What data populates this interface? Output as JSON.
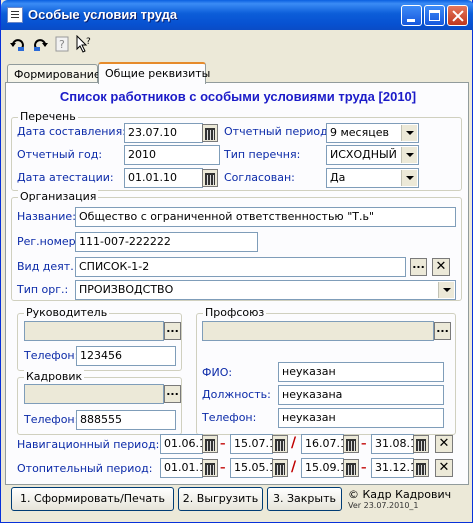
{
  "window": {
    "title": "Особые условия труда"
  },
  "toolbar": {
    "icons": [
      "undo-icon",
      "redo-icon",
      "help-icon",
      "context-help-icon"
    ]
  },
  "tabs": [
    {
      "label": "Формирование",
      "active": false
    },
    {
      "label": "Общие реквизиты",
      "active": true
    }
  ],
  "heading": "Список работников с особыми условиями труда [2010]",
  "perechen": {
    "legend": "Перечень",
    "date_label": "Дата составления:",
    "date_value": "23.07.10",
    "year_label": "Отчетный год:",
    "year_value": "2010",
    "attest_label": "Дата атестации:",
    "attest_value": "01.01.10",
    "period_label": "Отчетный период:",
    "period_value": "9 месяцев",
    "type_label": "Тип перечня:",
    "type_value": "ИСХОДНЫЙ",
    "agreed_label": "Согласован:",
    "agreed_value": "Да"
  },
  "org": {
    "legend": "Организация",
    "name_label": "Название:",
    "name_value": "Общество с ограниченной ответственностью \"Т.ь\"",
    "reg_label": "Рег.номер:",
    "reg_value": "111-007-222222",
    "activity_label": "Вид деят.:",
    "activity_value": "СПИСОК-1-2",
    "orgtype_label": "Тип орг.:",
    "orgtype_value": "ПРОИЗВОДСТВО"
  },
  "director": {
    "legend": "Руководитель",
    "value": "",
    "phone_label": "Телефон:",
    "phone_value": "123456"
  },
  "hr": {
    "legend": "Кадровик",
    "value": "",
    "phone_label": "Телефон:",
    "phone_value": "888555"
  },
  "union": {
    "legend": "Профсоюз",
    "value": "",
    "fio_label": "ФИО:",
    "fio_value": "неуказан",
    "position_label": "Должность:",
    "position_value": "неуказана",
    "phone_label": "Телефон:",
    "phone_value": "неуказан"
  },
  "periods": {
    "nav_label": "Навигационный период:",
    "nav": [
      "01.06.1",
      "15.07.1",
      "16.07.1",
      "31.08.1"
    ],
    "heat_label": "Отопительный период:",
    "heat": [
      "01.01.1",
      "15.05.1",
      "15.09.1",
      "31.12.1"
    ],
    "dash": "–",
    "slash": "/",
    "clear": "✕"
  },
  "buttons": {
    "generate": "1. Сформировать/Печать",
    "export": "2. Выгрузить",
    "close": "3. Закрыть",
    "dots": "..."
  },
  "footer": {
    "copyright": "© Кадр Кадрович",
    "version": "Ver 23.07.2010_1"
  }
}
